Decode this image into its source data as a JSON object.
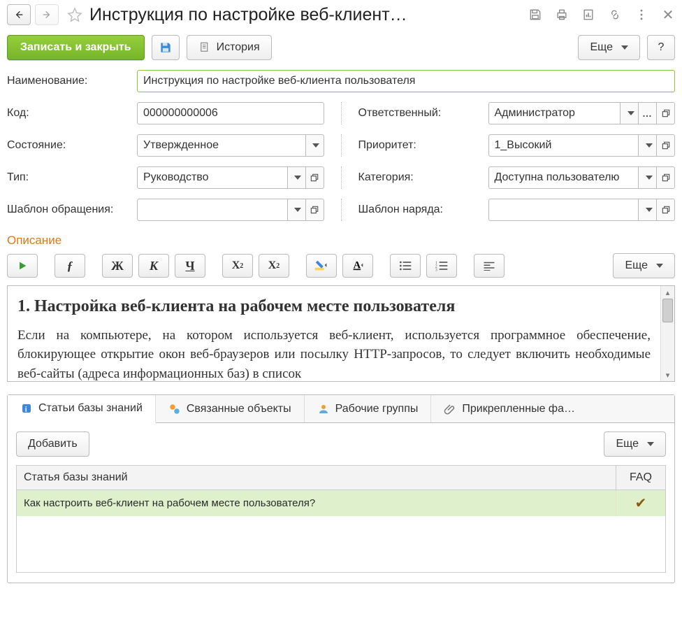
{
  "page_title": "Инструкция по настройке веб-клиент…",
  "cmd": {
    "primary": "Записать и закрыть",
    "history": "История",
    "more": "Еще",
    "help": "?"
  },
  "fields": {
    "name_label": "Наименование:",
    "name_value": "Инструкция по настройке веб-клиента пользователя",
    "code_label": "Код:",
    "code_value": "000000000006",
    "responsible_label": "Ответственный:",
    "responsible_value": "Администратор",
    "state_label": "Состояние:",
    "state_value": "Утвержденное",
    "priority_label": "Приоритет:",
    "priority_value": "1_Высокий",
    "type_label": "Тип:",
    "type_value": "Руководство",
    "category_label": "Категория:",
    "category_value": "Доступна пользователю",
    "request_template_label": "Шаблон обращения:",
    "request_template_value": "",
    "workorder_template_label": "Шаблон наряда:",
    "workorder_template_value": ""
  },
  "description": {
    "section_title": "Описание",
    "more": "Еще",
    "content_title": "1. Настройка веб-клиента на рабочем месте пользователя",
    "content_body": "Если на компьютере, на котором используется веб-клиент, используется программное обеспечение, блокирующее открытие окон веб-браузеров или посылку HTTP-запросов, то следует включить необходимые веб-сайты (адреса информационных баз) в список"
  },
  "tabs": {
    "kb": "Статьи базы знаний",
    "linked": "Связанные объекты",
    "workgroups": "Рабочие группы",
    "attachments": "Прикрепленные фа…"
  },
  "sub": {
    "add": "Добавить",
    "more": "Еще"
  },
  "table": {
    "col_article": "Статья базы знаний",
    "col_faq": "FAQ",
    "rows": [
      {
        "article": "Как настроить веб-клиент на рабочем месте пользователя?",
        "faq": true
      }
    ]
  }
}
